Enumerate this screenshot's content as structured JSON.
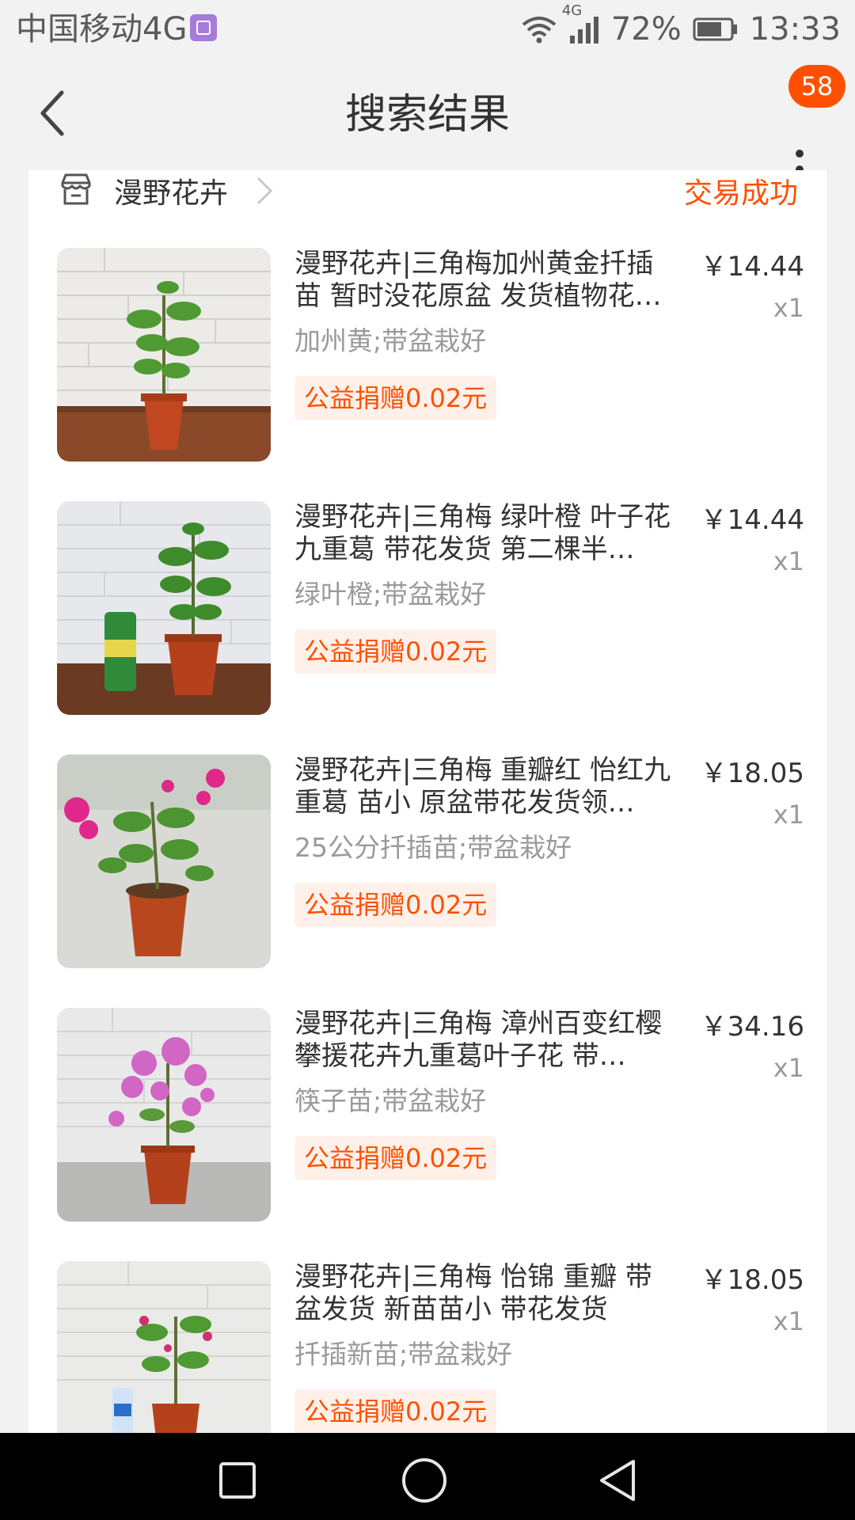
{
  "status_bar": {
    "carrier": "中国移动4G",
    "network": "4G",
    "battery": "72%",
    "time": "13:33",
    "icons": [
      "gallery-icon",
      "wifi-icon",
      "signal-icon",
      "battery-icon"
    ]
  },
  "header": {
    "title": "搜索结果",
    "badge": "58",
    "icons": [
      "back-arrow-icon",
      "more-icon"
    ]
  },
  "shop": {
    "name": "漫野花卉",
    "status": "交易成功",
    "icons": [
      "store-icon",
      "chevron-right-icon"
    ]
  },
  "items": [
    {
      "title": "漫野花卉|三角梅加州黄金扦插苗 暂时没花原盆 发货植物花…",
      "sku": "加州黄;带盆栽好",
      "charity": "公益捐赠0.02元",
      "price": "￥14.44",
      "qty": "x1"
    },
    {
      "title": "漫野花卉|三角梅 绿叶橙 叶子花九重葛 带花发货 第二棵半…",
      "sku": "绿叶橙;带盆栽好",
      "charity": "公益捐赠0.02元",
      "price": "￥14.44",
      "qty": "x1"
    },
    {
      "title": "漫野花卉|三角梅 重瓣红 怡红九重葛 苗小 原盆带花发货领…",
      "sku": "25公分扦插苗;带盆栽好",
      "charity": "公益捐赠0.02元",
      "price": "￥18.05",
      "qty": "x1"
    },
    {
      "title": "漫野花卉|三角梅 漳州百变红樱 攀援花卉九重葛叶子花 带…",
      "sku": "筷子苗;带盆栽好",
      "charity": "公益捐赠0.02元",
      "price": "￥34.16",
      "qty": "x1"
    },
    {
      "title": "漫野花卉|三角梅 怡锦 重瓣 带盆发货 新苗苗小 带花发货",
      "sku": "扦插新苗;带盆栽好",
      "charity": "公益捐赠0.02元",
      "price": "￥18.05",
      "qty": "x1"
    }
  ],
  "nav_bar": {
    "icons": [
      "recent-apps-icon",
      "home-icon",
      "back-icon"
    ]
  },
  "colors": {
    "accent": "#ff5000",
    "charity_bg": "#fff1ea",
    "background": "#f2f2f2",
    "card": "#ffffff"
  }
}
